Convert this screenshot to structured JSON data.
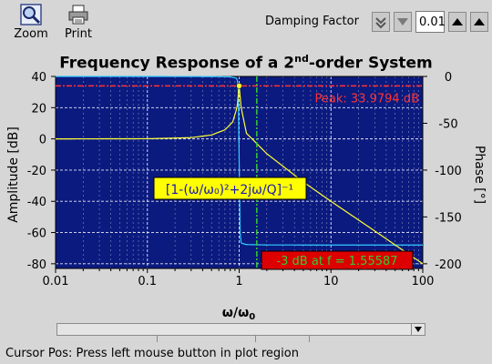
{
  "toolbar": {
    "zoom_label": "Zoom",
    "print_label": "Print",
    "damping_label": "Damping Factor",
    "damping_value": "0.01"
  },
  "plot": {
    "title_main": "Frequency Response of a 2",
    "title_sup": "nd",
    "title_end": "-order System",
    "peak_label": "Peak: 33.9794 dB",
    "cutoff_label": "-3 dB at f = 1.55587",
    "formula_label": "[1-(ω/ω₀)²+2jω/Q]⁻¹"
  },
  "status": {
    "text": "Cursor Pos: Press left mouse button in plot region"
  },
  "colors": {
    "plot_bg": "#0b1a7f",
    "amplitude": "#ffff33",
    "phase": "#33ccff",
    "peak_marker": "#ff3333",
    "cutoff_marker": "#33cc33",
    "formula_bg": "#ffff00",
    "cutoff_bg": "#dd0000"
  },
  "chart_data": {
    "type": "line",
    "title": "Frequency Response of a 2nd-order System",
    "xlabel": "ω/ω₀",
    "ylabel": "Amplitude [dB]",
    "y2label": "Phase [°]",
    "xscale": "log",
    "xlim": [
      0.01,
      100
    ],
    "ylim": [
      -83,
      40
    ],
    "y2lim": [
      -205,
      0
    ],
    "x_ticks": [
      "0.01",
      "0.1",
      "1",
      "10",
      "100"
    ],
    "y_ticks": [
      40,
      20,
      0,
      -20,
      -40,
      -60,
      -80
    ],
    "y2_ticks": [
      0,
      -50,
      -100,
      -150,
      -200
    ],
    "grid": true,
    "series": [
      {
        "name": "Amplitude",
        "axis": "left",
        "x": [
          0.01,
          0.1,
          0.3,
          0.5,
          0.7,
          0.85,
          0.95,
          1.0,
          1.05,
          1.2,
          1.55587,
          2,
          5,
          10,
          30,
          70,
          100
        ],
        "y": [
          0,
          0.1,
          0.8,
          2.5,
          5.8,
          10.8,
          20.2,
          33.98,
          20.2,
          3.6,
          -3,
          -9.5,
          -27.6,
          -40,
          -59,
          -73.8,
          -80
        ]
      },
      {
        "name": "Phase",
        "axis": "right",
        "x": [
          0.01,
          0.1,
          0.5,
          0.8,
          0.95,
          0.99,
          1.0,
          1.01,
          1.05,
          1.2,
          2,
          10,
          100
        ],
        "y": [
          0,
          0,
          -0.1,
          -0.4,
          -2,
          -20,
          -90,
          -160,
          -178,
          -179.5,
          -179.9,
          -180,
          -180
        ]
      }
    ],
    "annotations": [
      {
        "text": "Peak: 33.9794 dB",
        "y": 33.9794
      },
      {
        "text": "-3 dB at f = 1.55587",
        "x": 1.55587
      }
    ]
  }
}
